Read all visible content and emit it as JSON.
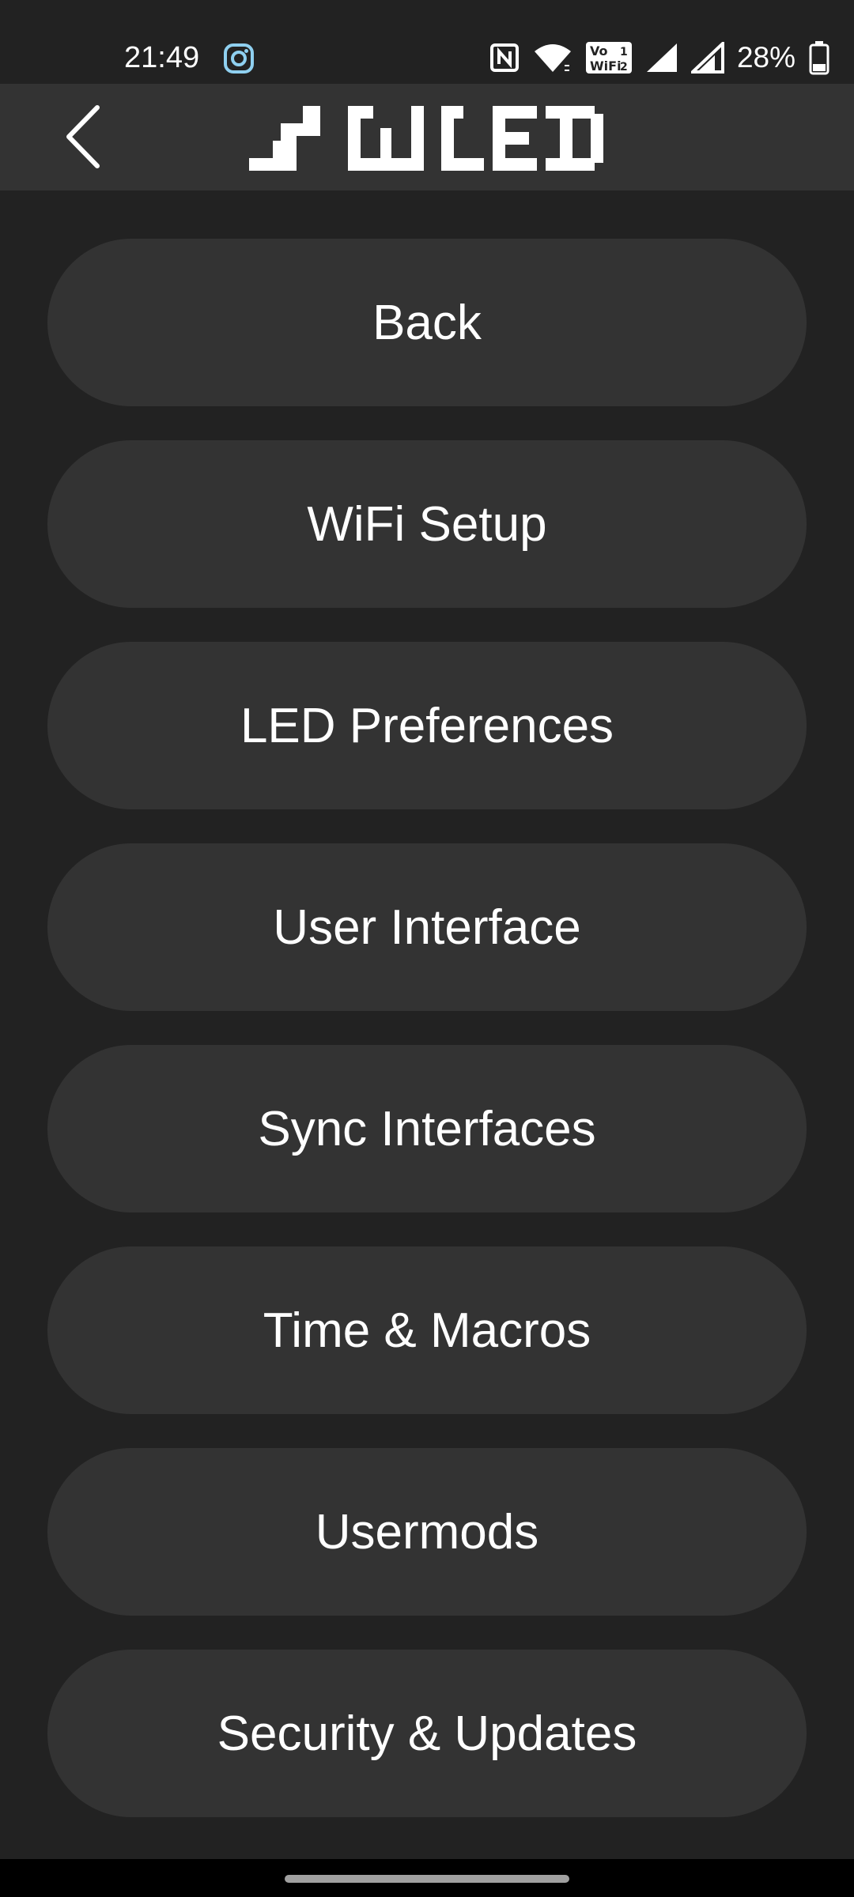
{
  "status_bar": {
    "time": "21:49",
    "battery_percent": "28%",
    "icons": [
      "instagram-icon",
      "nfc-icon",
      "wifi-icon",
      "vowifi-icon",
      "signal-1-icon",
      "signal-2-icon",
      "battery-icon"
    ]
  },
  "header": {
    "back_icon": "chevron-left-icon",
    "logo": "wled-logo"
  },
  "menu": {
    "items": [
      {
        "label": "Back"
      },
      {
        "label": "WiFi Setup"
      },
      {
        "label": "LED Preferences"
      },
      {
        "label": "User Interface"
      },
      {
        "label": "Sync Interfaces"
      },
      {
        "label": "Time & Macros"
      },
      {
        "label": "Usermods"
      },
      {
        "label": "Security & Updates"
      }
    ]
  },
  "colors": {
    "background": "#222222",
    "header": "#333333",
    "button": "#333333",
    "text": "#ffffff"
  }
}
